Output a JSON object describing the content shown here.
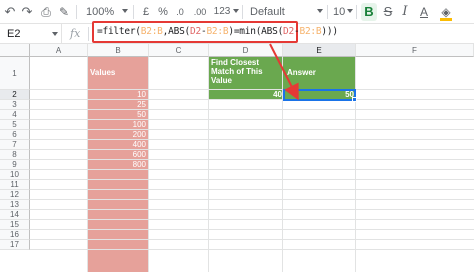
{
  "toolbar": {
    "zoom": "100%",
    "currency": "£",
    "percent": "%",
    "decrease_decimals": ".0",
    "increase_decimals": ".00",
    "more_formats": "123",
    "font_family": "Default (Ari...",
    "font_size": "10",
    "bold": "B",
    "strikethrough": "S",
    "italic": "I",
    "text_color": "A"
  },
  "formula_bar": {
    "cell_reference": "E2",
    "fx_label": "fx",
    "formula_parts": [
      "=filter(",
      "B2:B",
      ",ABS(",
      "D2",
      "-",
      "B2:B",
      ")=min(ABS(",
      "D2",
      "-",
      "B2:B",
      ")))"
    ]
  },
  "grid": {
    "columns": [
      "A",
      "B",
      "C",
      "D",
      "E",
      "F"
    ],
    "rows": [
      "1",
      "2",
      "3",
      "4",
      "5",
      "6",
      "7",
      "8",
      "9",
      "10",
      "11",
      "12",
      "13",
      "14",
      "15",
      "16",
      "17"
    ],
    "selected_column": "E",
    "selected_row": "2"
  },
  "sheet": {
    "values_header": "Values",
    "values": [
      "10",
      "25",
      "50",
      "100",
      "200",
      "400",
      "600",
      "800"
    ],
    "find_label": "Find Closest Match of This Value",
    "answer_label": "Answer",
    "find_value": "40",
    "answer_value": "50"
  },
  "colors": {
    "values_fill": "#e6a19a",
    "green_fill": "#6aa84f",
    "highlight_border": "#e53935",
    "selection": "#1a73e8"
  }
}
